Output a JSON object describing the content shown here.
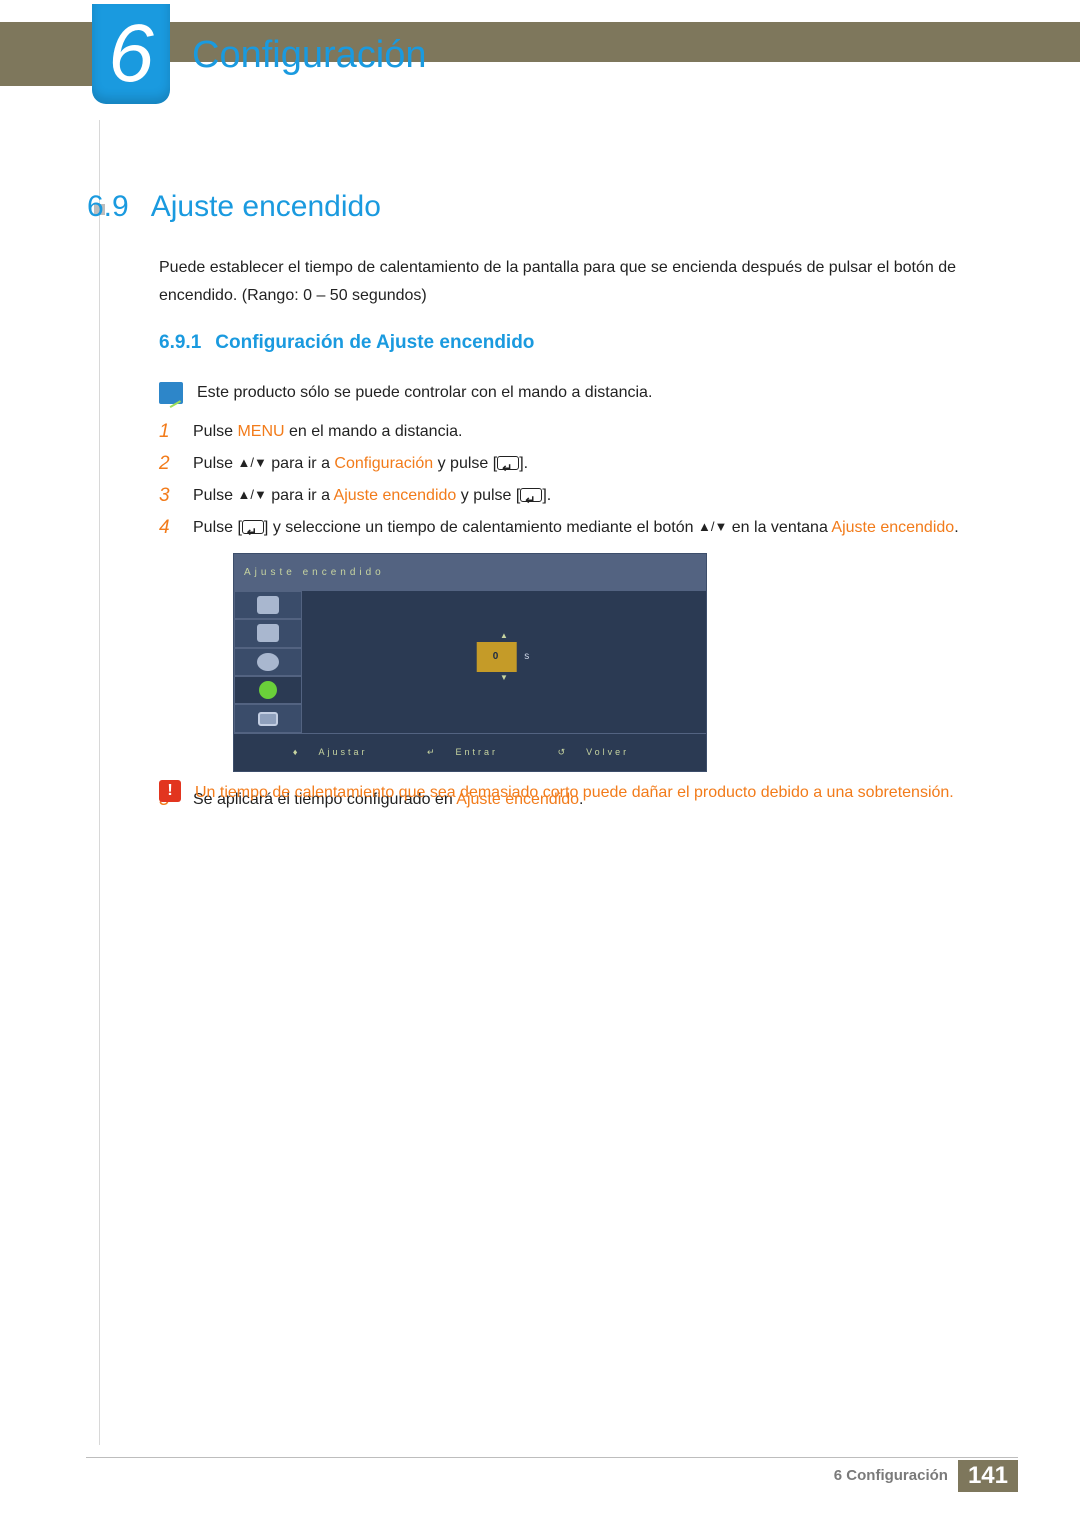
{
  "chapter": {
    "number": "6",
    "title": "Configuración"
  },
  "section": {
    "number": "6.9",
    "title": "Ajuste encendido"
  },
  "intro": "Puede establecer el tiempo de calentamiento de la pantalla para que se encienda después de pulsar el botón de encendido. (Rango: 0 – 50 segundos)",
  "subsection": {
    "number": "6.9.1",
    "title": "Configuración de Ajuste encendido"
  },
  "note": "Este producto sólo se puede controlar con el mando a distancia.",
  "steps": {
    "s1": {
      "num": "1",
      "pre": "Pulse ",
      "hi1": "MENU",
      "post": " en el mando a distancia."
    },
    "s2": {
      "num": "2",
      "pre": "Pulse ",
      "mid": " para ir a ",
      "hi1": "Configuración",
      "post": " y pulse [",
      "end": "]."
    },
    "s3": {
      "num": "3",
      "pre": "Pulse ",
      "mid": " para ir a ",
      "hi1": "Ajuste encendido",
      "post": " y pulse [",
      "end": "]."
    },
    "s4": {
      "num": "4",
      "pre": "Pulse [",
      "mid1": "] y seleccione un tiempo de calentamiento mediante el botón ",
      "mid2": " en la ventana ",
      "hi1": "Ajuste encendido",
      "end": "."
    },
    "s5": {
      "num": "5",
      "pre": "Se aplicará el tiempo configurado en ",
      "hi1": "Ajuste encendido",
      "end": "."
    }
  },
  "osd": {
    "title": "Ajuste encendido",
    "value": "0",
    "unit": "s",
    "footer": {
      "a": "Ajustar",
      "b": "Entrar",
      "c": "Volver"
    }
  },
  "warning": "Un tiempo de calentamiento que sea demasiado corto puede dañar el producto debido a una sobretensión.",
  "footer": {
    "label": "6 Configuración",
    "page": "141"
  }
}
